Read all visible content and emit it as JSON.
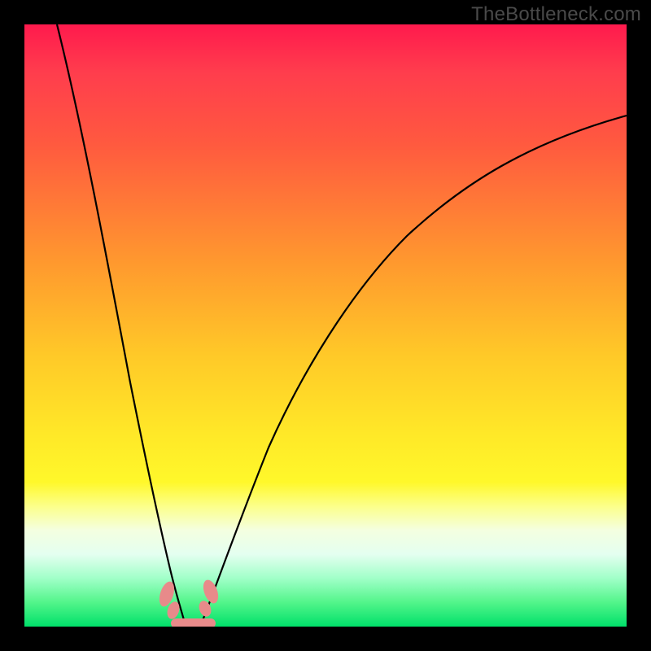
{
  "watermark": "TheBottleneck.com",
  "colors": {
    "frame": "#000000",
    "gradient_top": "#ff1a4d",
    "gradient_mid": "#ffe828",
    "gradient_bottom": "#00e06a",
    "curve": "#000000",
    "marker": "#e88a8a"
  },
  "chart_data": {
    "type": "line",
    "title": "",
    "xlabel": "",
    "ylabel": "",
    "xlim": [
      0,
      100
    ],
    "ylim": [
      0,
      100
    ],
    "grid": false,
    "legend": false,
    "note": "Background encodes bottleneck severity: red = high (bad), green = low (good). Two curves plot bottleneck percentage vs. an implicit x-axis; both dip to ~0 near x≈25 (the ideal match point). The left curve rises steeply toward 100 at x≈0; the right curve rises gradually toward ~80 at x≈100.",
    "series": [
      {
        "name": "left-curve",
        "x": [
          0,
          2,
          4,
          6,
          8,
          10,
          12,
          14,
          16,
          18,
          20,
          22,
          24,
          25,
          26
        ],
        "y": [
          100,
          92,
          84,
          76,
          68,
          60,
          52,
          44,
          36,
          28,
          20,
          12,
          4,
          0,
          0
        ]
      },
      {
        "name": "right-curve",
        "x": [
          26,
          28,
          30,
          32,
          35,
          40,
          45,
          50,
          55,
          60,
          65,
          70,
          75,
          80,
          85,
          90,
          95,
          100
        ],
        "y": [
          0,
          4,
          9,
          14,
          21,
          31,
          39,
          46,
          52,
          57,
          61,
          65,
          68,
          71,
          74,
          76,
          78,
          80
        ]
      }
    ],
    "markers": [
      {
        "name": "left-band-marker",
        "x": 22.5,
        "y": 6
      },
      {
        "name": "right-band-marker",
        "x": 29.0,
        "y": 6
      }
    ],
    "ideal_band": {
      "x_start": 23,
      "x_end": 29,
      "y": 0
    }
  }
}
